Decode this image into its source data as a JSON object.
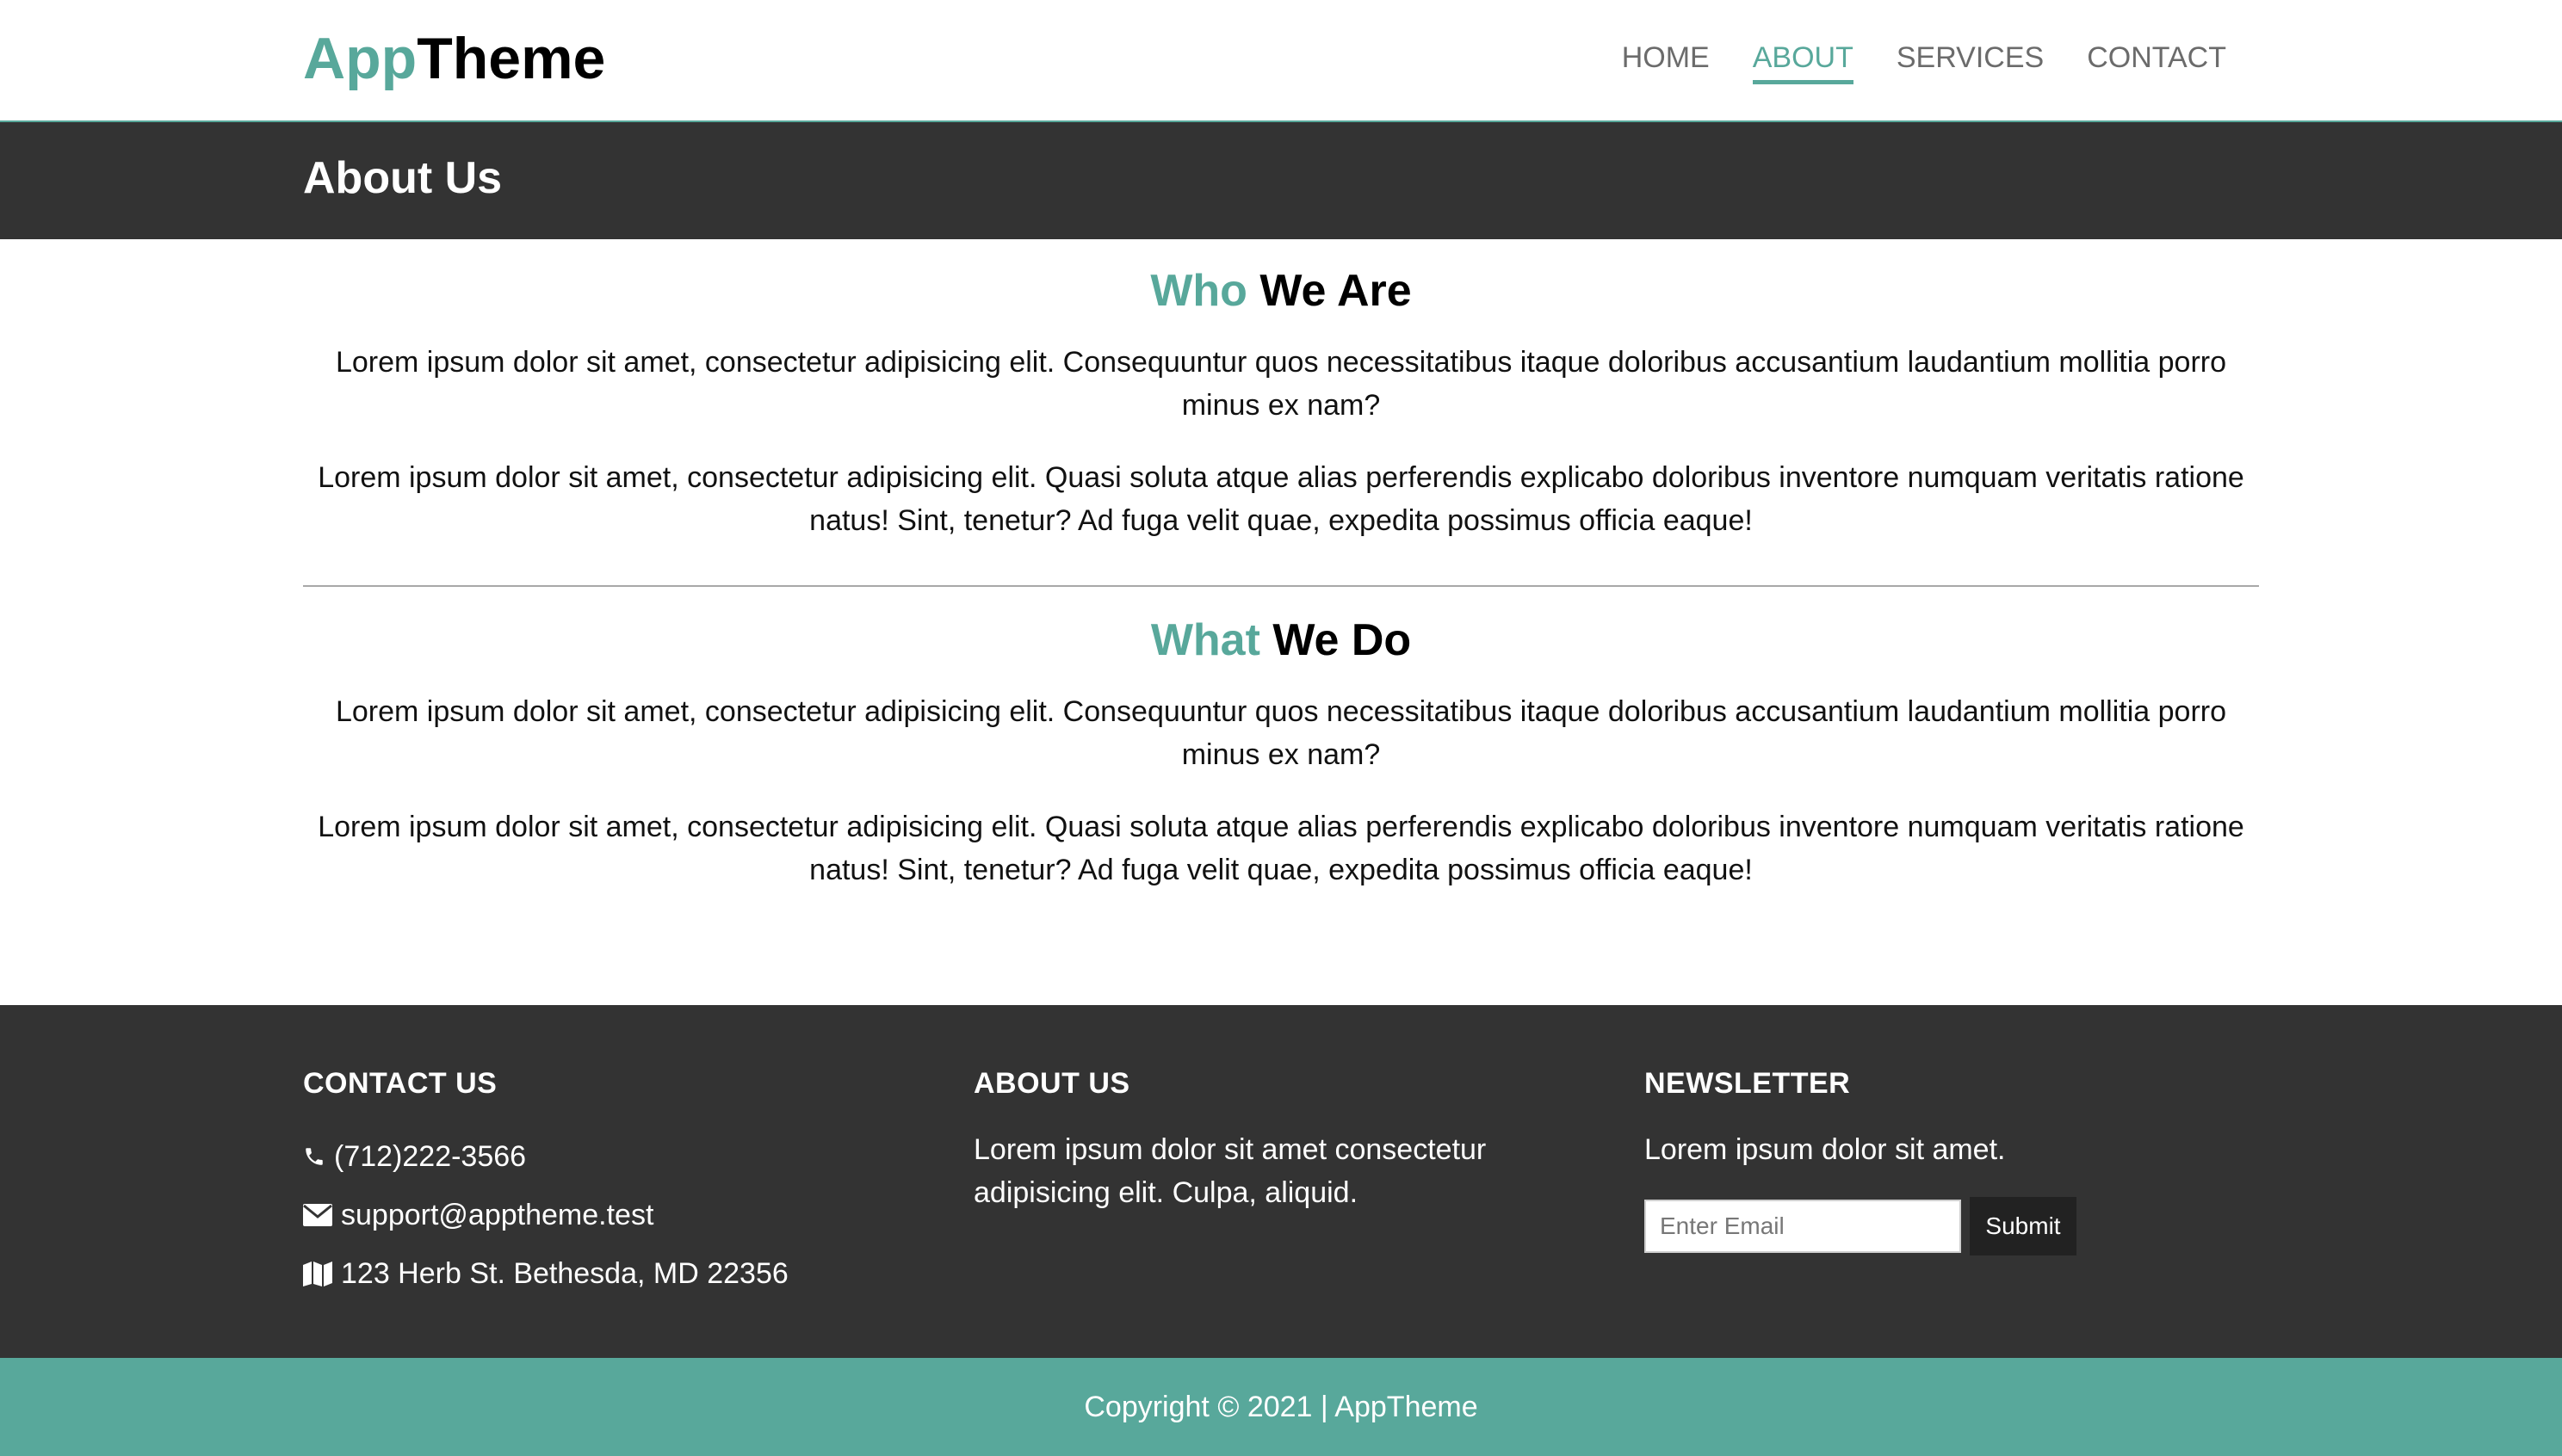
{
  "header": {
    "logo_accent": "App",
    "logo_rest": "Theme",
    "nav": [
      {
        "label": "HOME",
        "active": false
      },
      {
        "label": "ABOUT",
        "active": true
      },
      {
        "label": "SERVICES",
        "active": false
      },
      {
        "label": "CONTACT",
        "active": false
      }
    ]
  },
  "banner": {
    "title": "About Us"
  },
  "sections": [
    {
      "title_accent": "Who",
      "title_rest": "We Are",
      "paragraphs": [
        "Lorem ipsum dolor sit amet, consectetur adipisicing elit. Consequuntur quos necessitatibus itaque doloribus accusantium laudantium mollitia porro minus ex nam?",
        "Lorem ipsum dolor sit amet, consectetur adipisicing elit. Quasi soluta atque alias perferendis explicabo doloribus inventore numquam veritatis ratione natus! Sint, tenetur? Ad fuga velit quae, expedita possimus officia eaque!"
      ]
    },
    {
      "title_accent": "What",
      "title_rest": "We Do",
      "paragraphs": [
        "Lorem ipsum dolor sit amet, consectetur adipisicing elit. Consequuntur quos necessitatibus itaque doloribus accusantium laudantium mollitia porro minus ex nam?",
        "Lorem ipsum dolor sit amet, consectetur adipisicing elit. Quasi soluta atque alias perferendis explicabo doloribus inventore numquam veritatis ratione natus! Sint, tenetur? Ad fuga velit quae, expedita possimus officia eaque!"
      ]
    }
  ],
  "footer": {
    "contact": {
      "heading": "CONTACT US",
      "phone": "(712)222-3566",
      "email": "support@apptheme.test",
      "address": "123 Herb St. Bethesda, MD 22356",
      "phone_icon": "phone-icon",
      "email_icon": "envelope-icon",
      "address_icon": "map-icon"
    },
    "about": {
      "heading": "ABOUT US",
      "text": "Lorem ipsum dolor sit amet consectetur adipisicing elit. Culpa, aliquid."
    },
    "newsletter": {
      "heading": "NEWSLETTER",
      "text": "Lorem ipsum dolor sit amet.",
      "email_placeholder": "Enter Email",
      "email_value": "",
      "submit_label": "Submit"
    }
  },
  "copyright": "Copyright © 2021 | AppTheme",
  "colors": {
    "accent": "#58a89b",
    "dark": "#333333",
    "button": "#222222"
  }
}
